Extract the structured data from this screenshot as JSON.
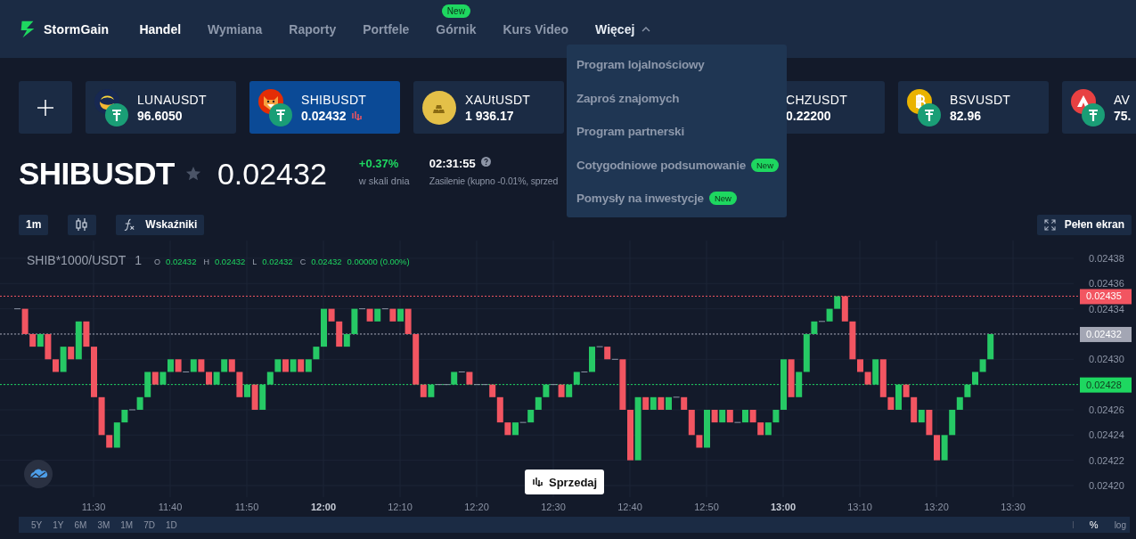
{
  "nav": {
    "brand": "StormGain",
    "items": [
      {
        "label": "Handel",
        "selected": true
      },
      {
        "label": "Wymiana",
        "selected": false
      },
      {
        "label": "Raporty",
        "selected": false
      },
      {
        "label": "Portfele",
        "selected": false
      },
      {
        "label": "Górnik",
        "selected": false,
        "badge": "New"
      },
      {
        "label": "Kurs Video",
        "selected": false
      },
      {
        "label": "Więcej",
        "selected": false,
        "expanded": true
      }
    ]
  },
  "menu": [
    {
      "label": "Program lojalnościowy"
    },
    {
      "label": "Zaproś znajomych"
    },
    {
      "label": "Program partnerski"
    },
    {
      "label": "Cotygodniowe podsumowanie",
      "badge": "New"
    },
    {
      "label": "Pomysły na inwestycje",
      "badge": "New"
    }
  ],
  "tickers": [
    {
      "symbol": "LUNAUSDT",
      "price": "96.6050",
      "kind": "moon",
      "paired": true,
      "selected": false,
      "trend_down": false
    },
    {
      "symbol": "SHIBUSDT",
      "price": "0.02432",
      "kind": "dog",
      "paired": true,
      "selected": true,
      "trend_down": true
    },
    {
      "symbol": "XAUtUSDT",
      "price": "1 936.17",
      "kind": "gold",
      "paired": false,
      "selected": false,
      "trend_down": false
    },
    {
      "symbol": "CHZUSDT",
      "price": "0.22200",
      "kind": "covered",
      "selected": false,
      "trend_down": false
    },
    {
      "symbol": "BSVUSDT",
      "price": "82.96",
      "kind": "bitcoin",
      "paired": true,
      "selected": false,
      "trend_down": false
    },
    {
      "symbol": "AV",
      "price": "75.",
      "kind": "triangle",
      "paired": true,
      "selected": false,
      "trend_down": false
    }
  ],
  "instrument": {
    "symbol": "SHIBUSDT",
    "price": "0.02432",
    "change": "+0.37%",
    "change_label": "w skali dnia",
    "time": "02:31:55",
    "funding": "Zasilenie (kupno -0.01%, sprzed"
  },
  "toolbar": {
    "interval": "1m",
    "indicators": "Wskaźniki",
    "fullscreen": "Pełen ekran"
  },
  "legend": {
    "title": "SHIB*1000/USDT",
    "interval": "1",
    "values": [
      {
        "key": "O",
        "value": "0.02432"
      },
      {
        "key": "H",
        "value": "0.02432"
      },
      {
        "key": "L",
        "value": "0.02432"
      },
      {
        "key": "C",
        "value": "0.02432"
      }
    ],
    "change": "0.00000 (0.00%)"
  },
  "price_axis": [
    "0.02438",
    "0.02436",
    "0.02434",
    "0.02430",
    "0.02426",
    "0.02424",
    "0.02422",
    "0.02420"
  ],
  "price_tags": [
    {
      "label": "0.02435",
      "color": "#f25561"
    },
    {
      "label": "0.02432",
      "color": "#a3a6b4"
    },
    {
      "label": "0.02428",
      "color": "#1ed760"
    }
  ],
  "time_axis": [
    {
      "label": "11:30",
      "bold": false
    },
    {
      "label": "11:40",
      "bold": false
    },
    {
      "label": "11:50",
      "bold": false
    },
    {
      "label": "12:00",
      "bold": true
    },
    {
      "label": "12:10",
      "bold": false
    },
    {
      "label": "12:20",
      "bold": false
    },
    {
      "label": "12:30",
      "bold": false
    },
    {
      "label": "12:40",
      "bold": false
    },
    {
      "label": "12:50",
      "bold": false
    },
    {
      "label": "13:00",
      "bold": true
    },
    {
      "label": "13:10",
      "bold": false
    },
    {
      "label": "13:20",
      "bold": false
    },
    {
      "label": "13:30",
      "bold": false
    }
  ],
  "sell_button": "Sprzedaj",
  "ranges": [
    "5Y",
    "1Y",
    "6M",
    "3M",
    "1M",
    "7D",
    "1D"
  ],
  "scale_options": [
    "%",
    "log"
  ]
}
